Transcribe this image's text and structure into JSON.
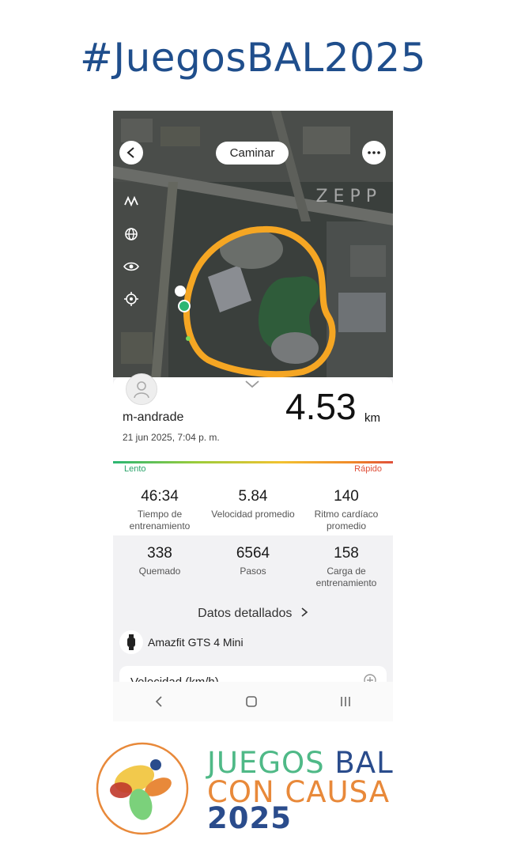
{
  "headline": "#JuegosBAL2025",
  "map": {
    "mode_label": "Caminar",
    "watermark": "ZEPP"
  },
  "summary": {
    "username": "m-andrade",
    "datetime": "21 jun 2025, 7:04 p. m.",
    "distance": "4.53",
    "distance_unit": "km",
    "pace_slow": "Lento",
    "pace_fast": "Rápido"
  },
  "stats": [
    {
      "value": "46:34",
      "label": "Tiempo de entrenamiento"
    },
    {
      "value": "5.84",
      "label": "Velocidad promedio"
    },
    {
      "value": "140",
      "label": "Ritmo cardíaco promedio"
    },
    {
      "value": "338",
      "label": "Quemado"
    },
    {
      "value": "6564",
      "label": "Pasos"
    },
    {
      "value": "158",
      "label": "Carga de entrenamiento"
    }
  ],
  "details_link": "Datos detallados",
  "device_name": "Amazfit GTS 4 Mini",
  "chart_card_title": "Velocidad (km/h)",
  "logo": {
    "line1_a": "JUEGOS ",
    "line1_b": "BAL",
    "line2": "CON CAUSA",
    "line3": "2025"
  },
  "colors": {
    "headline": "#1f4e8c",
    "route": "#f5a623",
    "logo_green": "#4fb987",
    "logo_blue": "#2a4c8c",
    "logo_orange": "#e8893a"
  }
}
